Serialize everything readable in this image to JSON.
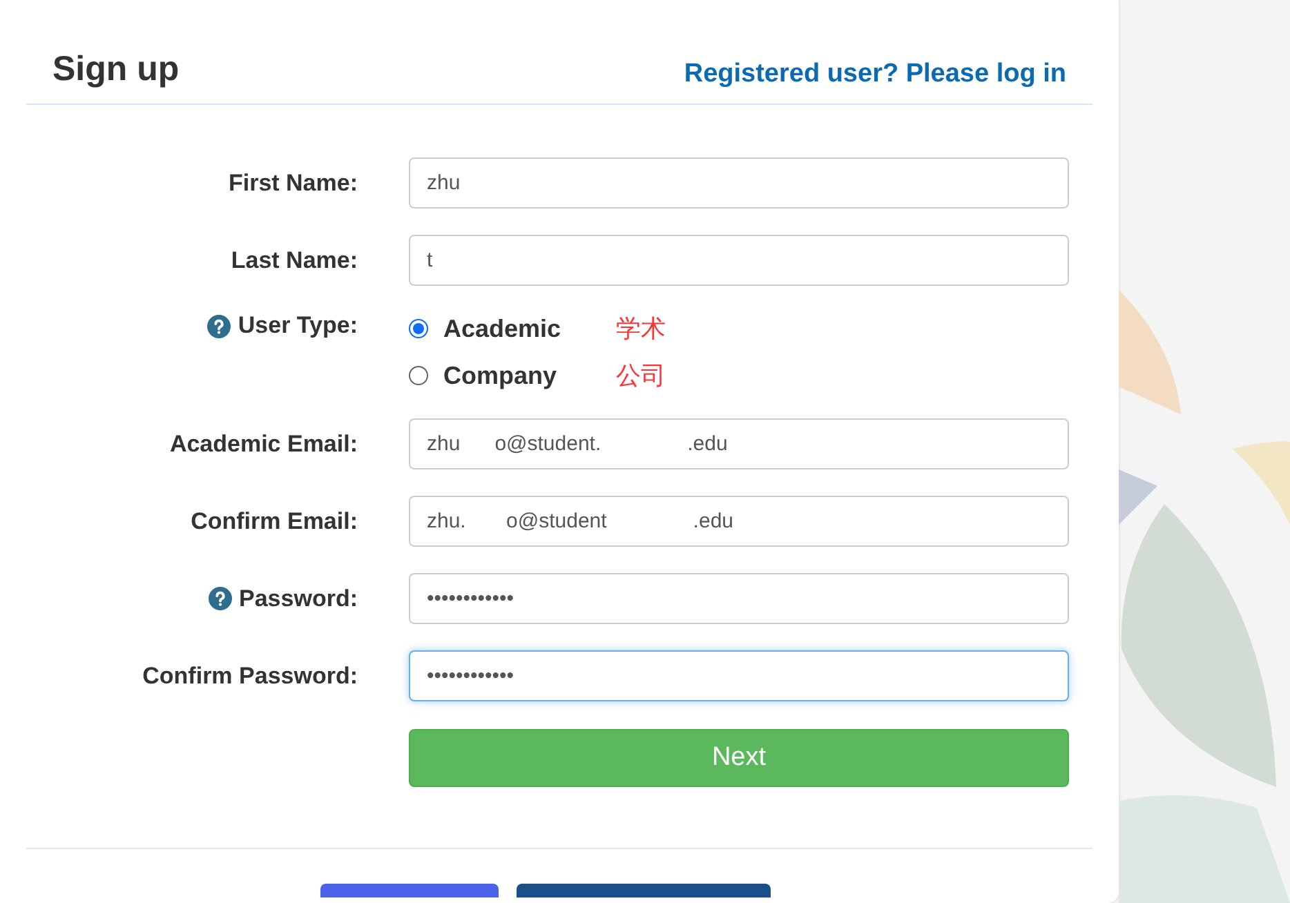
{
  "header": {
    "title": "Sign up",
    "login_link": "Registered user? Please log in"
  },
  "fields": [
    {
      "kind": "text",
      "label": "First Name:",
      "help": false,
      "value": "zhu",
      "focused": false
    },
    {
      "kind": "text",
      "label": "Last Name:",
      "help": false,
      "value": "t",
      "focused": false
    },
    {
      "kind": "radio",
      "label": "User Type:",
      "help": true,
      "options": [
        {
          "label": "Academic",
          "selected": true,
          "note": "学术"
        },
        {
          "label": "Company",
          "selected": false,
          "note": "公司"
        }
      ]
    },
    {
      "kind": "text",
      "label": "Academic Email:",
      "help": false,
      "value": "zhu      o@student.               .edu",
      "focused": false
    },
    {
      "kind": "text",
      "label": "Confirm Email:",
      "help": false,
      "value": "zhu.       o@student               .edu",
      "focused": false
    },
    {
      "kind": "text",
      "label": "Password:",
      "help": true,
      "value": "••••••••••••",
      "focused": false
    },
    {
      "kind": "text",
      "label": "Confirm Password:",
      "help": false,
      "value": "••••••••••••",
      "focused": true
    }
  ],
  "submit": "Next"
}
